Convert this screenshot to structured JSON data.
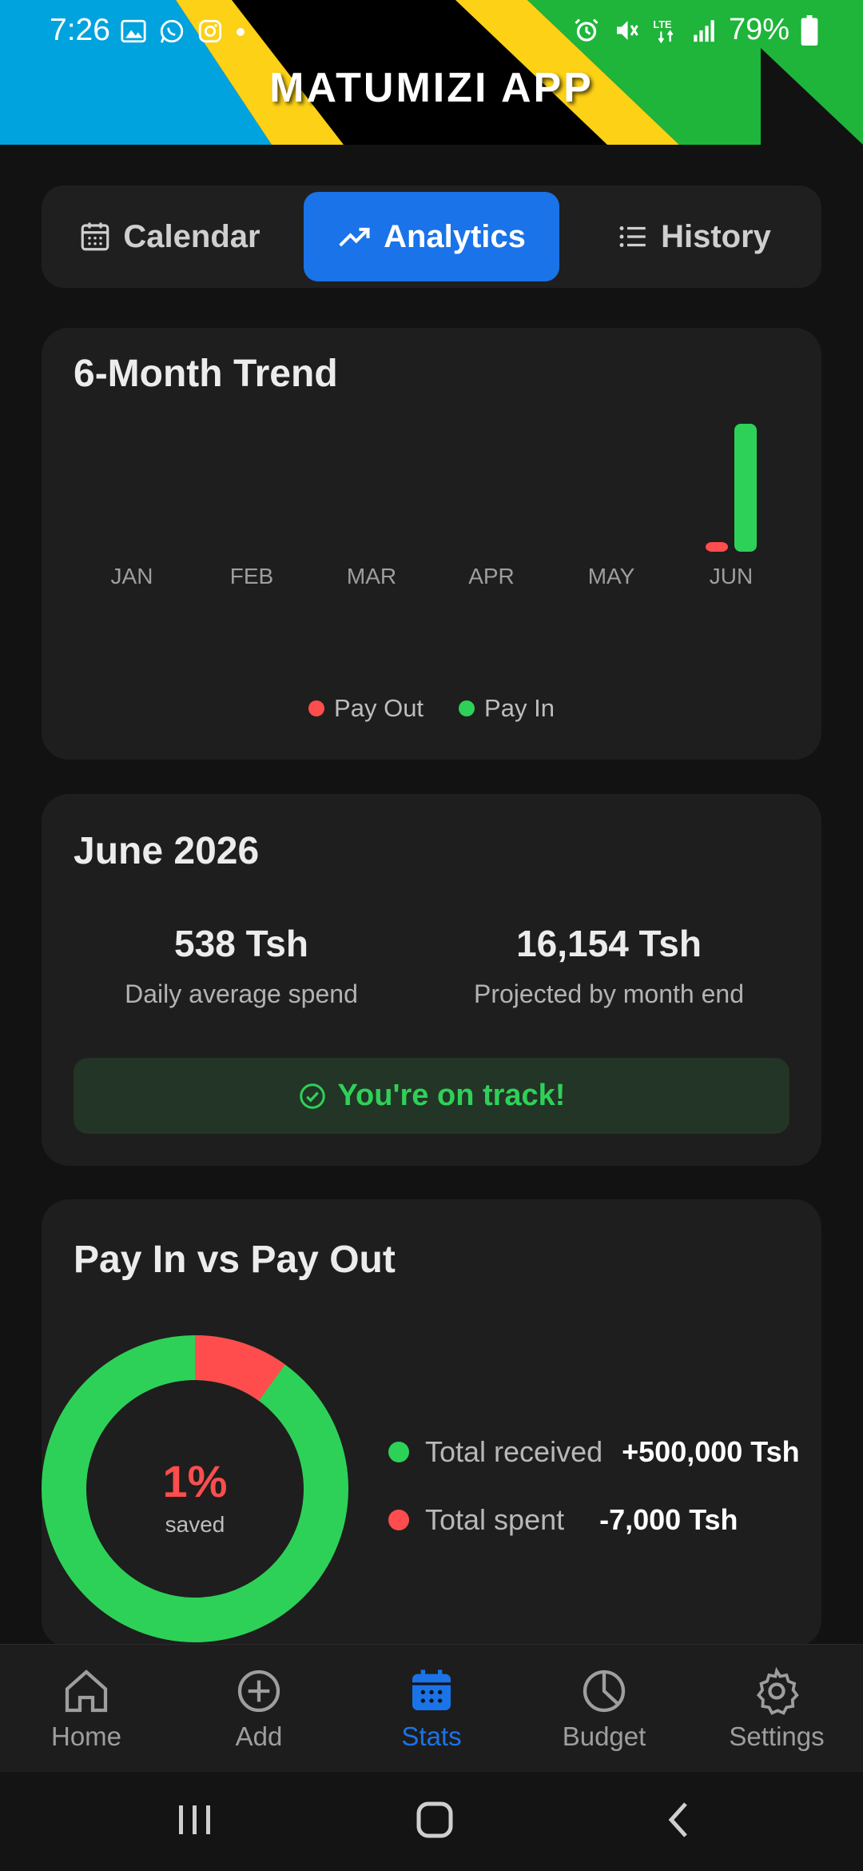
{
  "status_bar": {
    "time": "7:26",
    "battery": "79%",
    "left_icons": [
      "image-icon",
      "whatsapp-icon",
      "instagram-icon",
      "dot-icon"
    ],
    "right_icons": [
      "alarm-icon",
      "mute-icon",
      "lte-icon",
      "signal-icon",
      "battery-icon"
    ]
  },
  "header": {
    "title": "MATUMIZI APP"
  },
  "tabs": [
    {
      "label": "Calendar",
      "icon": "calendar-icon"
    },
    {
      "label": "Analytics",
      "icon": "trending-up-icon",
      "active": true
    },
    {
      "label": "History",
      "icon": "list-icon"
    }
  ],
  "trend": {
    "title": "6-Month Trend",
    "legend": {
      "pay_out": "Pay Out",
      "pay_in": "Pay In"
    }
  },
  "chart_data": {
    "type": "bar",
    "title": "6-Month Trend",
    "categories": [
      "JAN",
      "FEB",
      "MAR",
      "APR",
      "MAY",
      "JUN"
    ],
    "series": [
      {
        "name": "Pay Out",
        "values": [
          0,
          0,
          0,
          0,
          0,
          7000
        ],
        "color": "#ff4d4d"
      },
      {
        "name": "Pay In",
        "values": [
          0,
          0,
          0,
          0,
          0,
          500000
        ],
        "color": "#2ed158"
      }
    ],
    "ylim": [
      0,
      500000
    ],
    "grid": false,
    "legend_position": "bottom-center"
  },
  "month": {
    "title": "June 2026",
    "daily_avg_value": "538 Tsh",
    "daily_avg_label": "Daily average spend",
    "projected_value": "16,154 Tsh",
    "projected_label": "Projected by month end",
    "status_text": "You're on track!"
  },
  "payin": {
    "title": "Pay In vs Pay Out",
    "saved_pct": "1%",
    "saved_label": "saved",
    "received_label": "Total received",
    "received_value": "+500,000 Tsh",
    "spent_label": "Total spent",
    "spent_value": "-7,000 Tsh",
    "donut_spent_fraction": 0.1,
    "colors": {
      "received": "#2ed158",
      "spent": "#ff4d4d"
    }
  },
  "bottom_nav": [
    {
      "label": "Home",
      "icon": "home-icon"
    },
    {
      "label": "Add",
      "icon": "add-circle-icon"
    },
    {
      "label": "Stats",
      "icon": "stats-calendar-icon",
      "active": true
    },
    {
      "label": "Budget",
      "icon": "pie-chart-icon"
    },
    {
      "label": "Settings",
      "icon": "gear-icon"
    }
  ],
  "colors": {
    "accent": "#1a73e8",
    "green": "#2ed158",
    "red": "#ff4d4d",
    "card": "#1e1e1e",
    "background": "#121212"
  }
}
